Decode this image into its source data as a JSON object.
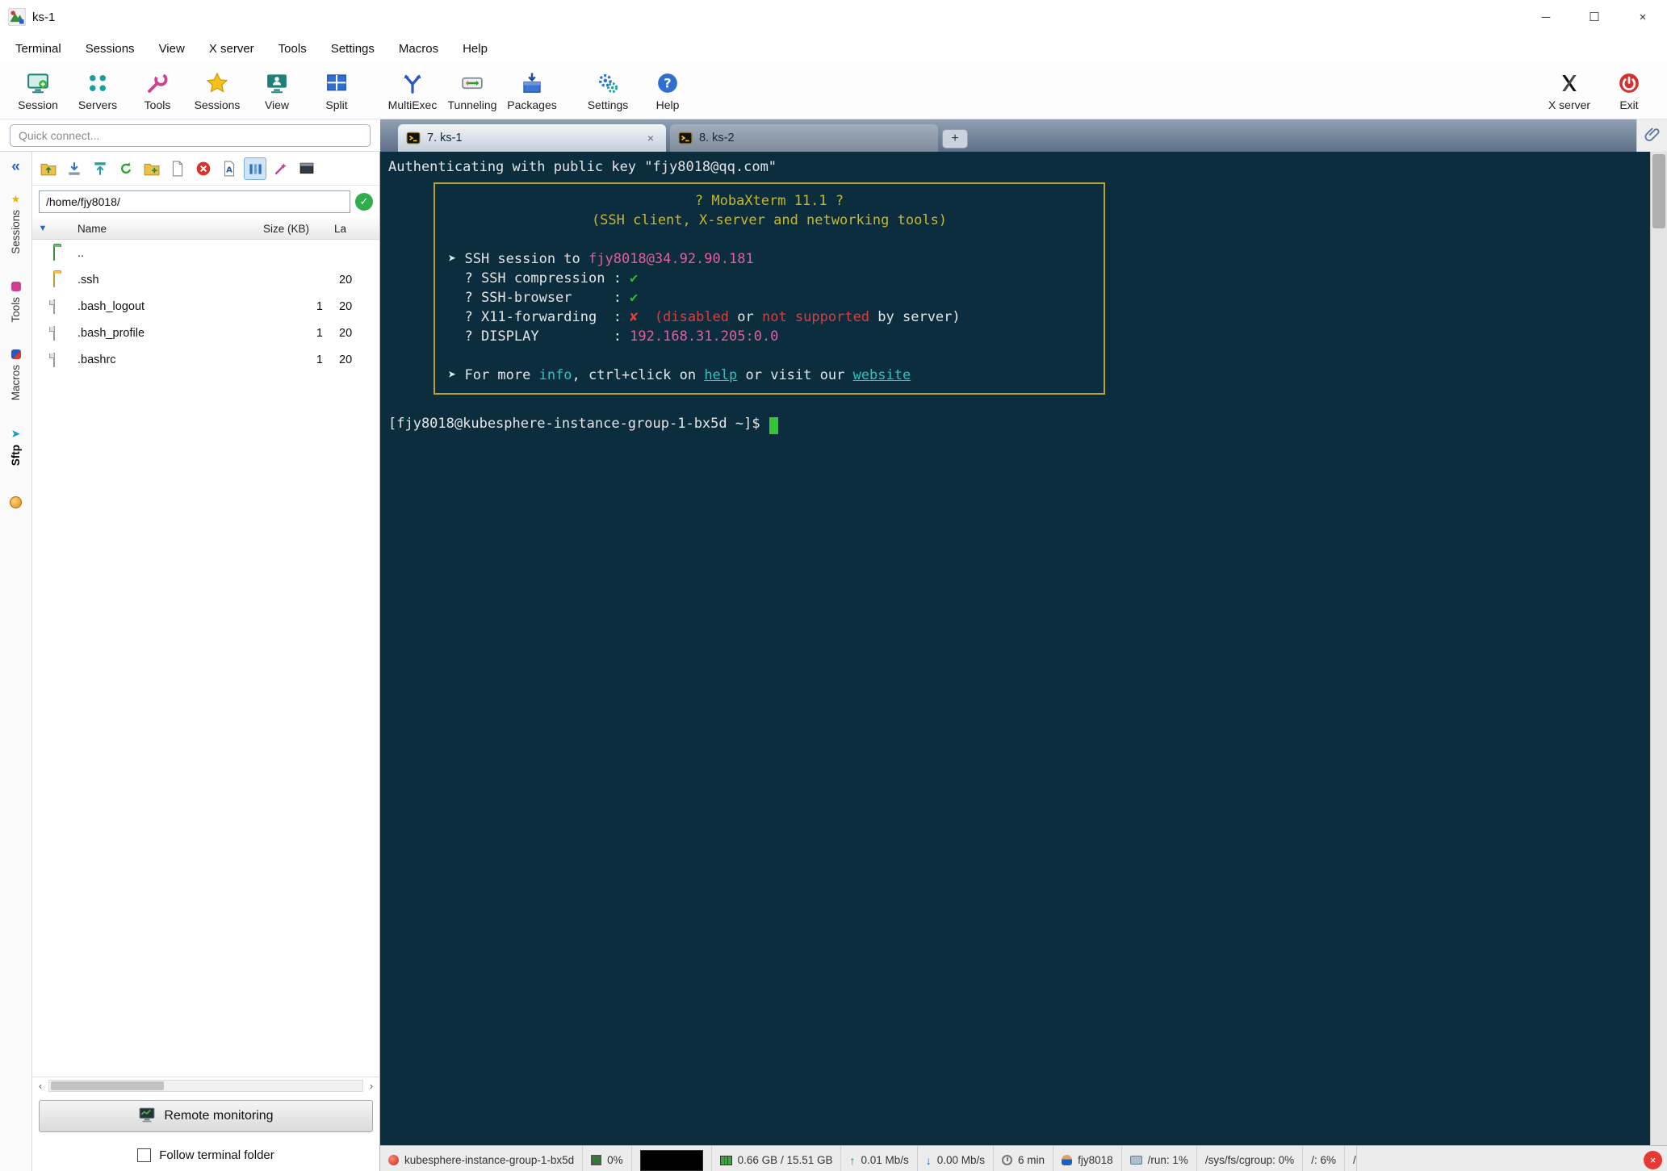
{
  "window": {
    "title": "ks-1"
  },
  "glyphs": {
    "minimize": "─",
    "maximize": "☐",
    "close": "×",
    "collapse": "«",
    "tab_close": "×",
    "new_tab": "+",
    "path_ok": "✓",
    "tree_expander": "▼",
    "scroll_left": "‹",
    "scroll_right": "›",
    "status_close": "×"
  },
  "menubar": {
    "items": [
      {
        "label": "Terminal"
      },
      {
        "label": "Sessions"
      },
      {
        "label": "View"
      },
      {
        "label": "X server"
      },
      {
        "label": "Tools"
      },
      {
        "label": "Settings"
      },
      {
        "label": "Macros"
      },
      {
        "label": "Help"
      }
    ]
  },
  "toolbar": {
    "left": [
      {
        "label": "Session"
      },
      {
        "label": "Servers"
      },
      {
        "label": "Tools"
      },
      {
        "label": "Sessions"
      },
      {
        "label": "View"
      },
      {
        "label": "Split"
      },
      {
        "label": "MultiExec"
      },
      {
        "label": "Tunneling"
      },
      {
        "label": "Packages"
      },
      {
        "label": "Settings"
      },
      {
        "label": "Help"
      }
    ],
    "right": [
      {
        "label": "X server"
      },
      {
        "label": "Exit"
      }
    ]
  },
  "quick_connect": {
    "placeholder": "Quick connect..."
  },
  "side_tabs": {
    "items": [
      {
        "label": "Sessions"
      },
      {
        "label": "Tools"
      },
      {
        "label": "Macros"
      },
      {
        "label": "Sftp",
        "active": true
      }
    ]
  },
  "sftp": {
    "path": "/home/fjy8018/",
    "columns": {
      "name": "Name",
      "size": "Size (KB)",
      "last": "La"
    },
    "rows": [
      {
        "name": "..",
        "size": "",
        "last": ""
      },
      {
        "name": ".ssh",
        "size": "",
        "last": "20"
      },
      {
        "name": ".bash_logout",
        "size": "1",
        "last": "20"
      },
      {
        "name": ".bash_profile",
        "size": "1",
        "last": "20"
      },
      {
        "name": ".bashrc",
        "size": "1",
        "last": "20"
      }
    ],
    "remote_monitoring_label": "Remote monitoring",
    "follow_label": "Follow terminal folder"
  },
  "tabs": {
    "items": [
      {
        "label": "7. ks-1",
        "active": true
      },
      {
        "label": "8. ks-2",
        "active": false
      }
    ]
  },
  "terminal": {
    "auth_segments": [
      {
        "t": "Authenticating with public key \"fjy8018@qq.com\"",
        "c": "w"
      }
    ],
    "banner": {
      "title": [
        {
          "t": "? MobaXterm 11.1 ?",
          "c": "y"
        }
      ],
      "subtitle": [
        {
          "t": "(SSH client, X-server and networking tools)",
          "c": "y"
        }
      ],
      "lines": [
        [
          {
            "t": "➤ SSH session to ",
            "c": "w"
          },
          {
            "t": "fjy8018@34.92.90.181",
            "c": "p"
          }
        ],
        [
          {
            "t": "  ? SSH compression : ",
            "c": "w"
          },
          {
            "t": "✔",
            "c": "g"
          }
        ],
        [
          {
            "t": "  ? SSH-browser     : ",
            "c": "w"
          },
          {
            "t": "✔",
            "c": "g"
          }
        ],
        [
          {
            "t": "  ? X11-forwarding  : ",
            "c": "w"
          },
          {
            "t": "✘",
            "c": "r"
          },
          {
            "t": "  ",
            "c": "w"
          },
          {
            "t": "(disabled",
            "c": "r"
          },
          {
            "t": " or ",
            "c": "w"
          },
          {
            "t": "not supported",
            "c": "r"
          },
          {
            "t": " by server)",
            "c": "w"
          }
        ],
        [
          {
            "t": "  ? DISPLAY         : ",
            "c": "w"
          },
          {
            "t": "192.168.31.205:0.0",
            "c": "p"
          }
        ],
        [
          {
            "t": "➤ For more ",
            "c": "w"
          },
          {
            "t": "info",
            "c": "c"
          },
          {
            "t": ", ctrl+click on ",
            "c": "w"
          },
          {
            "t": "help",
            "c": "cl"
          },
          {
            "t": " or visit our ",
            "c": "w"
          },
          {
            "t": "website",
            "c": "cl"
          }
        ]
      ]
    },
    "prompt": [
      {
        "t": "[fjy8018@kubesphere-instance-group-1-bx5d ~]$ ",
        "c": "w"
      }
    ]
  },
  "statusbar": {
    "segments": [
      {
        "text": "kubesphere-instance-group-1-bx5d"
      },
      {
        "text": "0%"
      },
      {
        "text": ""
      },
      {
        "text": "0.66 GB / 15.51 GB"
      },
      {
        "text": "0.01 Mb/s"
      },
      {
        "text": "0.00 Mb/s"
      },
      {
        "text": "6 min"
      },
      {
        "text": "fjy8018"
      },
      {
        "text": "/run: 1%"
      },
      {
        "text": "/sys/fs/cgroup: 0%"
      },
      {
        "text": "/: 6%"
      },
      {
        "text": "/"
      }
    ]
  },
  "colors": {
    "terminal_bg": "#0c2d3d",
    "terminal_fg": "#e6e6e6",
    "accent_yellow": "#c9b72b",
    "accent_pink": "#e05fa0",
    "accent_green": "#2dbe2d",
    "accent_red": "#e23c3c",
    "accent_cyan": "#2fc0c0",
    "cursor_green": "#35c435"
  }
}
